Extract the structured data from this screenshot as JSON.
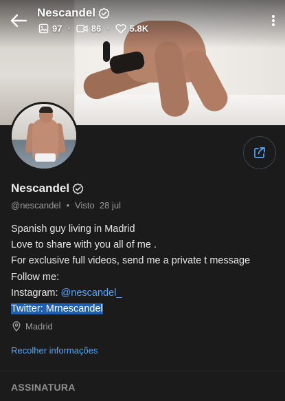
{
  "header": {
    "title": "Nescandel",
    "stats": {
      "photos": "97",
      "videos": "86",
      "likes": "5.8K"
    }
  },
  "profile": {
    "name": "Nescandel",
    "handle": "@nescandel",
    "separator": "•",
    "last_seen": "Visto  28 jul",
    "bio": {
      "line1": "Spanish guy living in Madrid",
      "line2": "Love to share with you all of me .",
      "line3": "For exclusive full videos, send me a private t message",
      "line4": "Follow me:",
      "instagram_label": "Instagram: ",
      "instagram_handle": "@nescandel_",
      "twitter_text": "Twitter: Mrnescandel"
    },
    "location": "Madrid",
    "collapse_link": "Recolher informações"
  },
  "sections": {
    "subscription_title": "ASSINATURA"
  },
  "colors": {
    "background": "#1b1b1b",
    "link": "#54a7ff",
    "text_muted": "#9c9c9c",
    "selection": "#1f5fb3"
  }
}
